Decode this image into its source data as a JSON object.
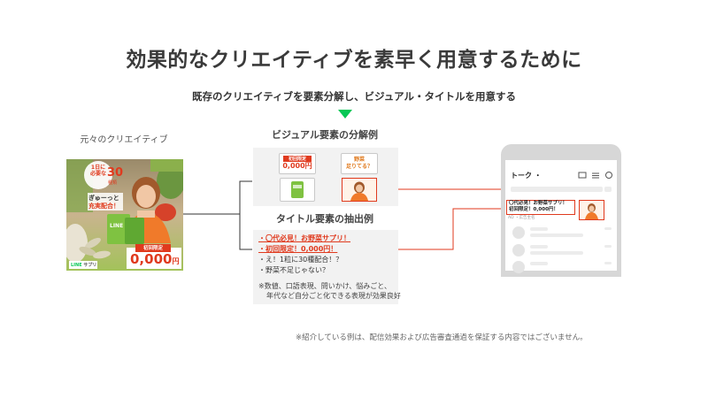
{
  "title": "効果的なクリエイティブを素早く用意するために",
  "subtitle": "既存のクリエイティブを要素分解し、ビジュアル・タイトルを用意する",
  "original_label": "元々のクリエイティブ",
  "creative": {
    "line1": "1日に",
    "line2": "必要な",
    "num": "30",
    "unit": "種類",
    "tagline1": "ぎゅーっと",
    "tagline2": "充実配合！",
    "badge_top": "初回限定",
    "price": "0,000",
    "price_unit": "円",
    "logo": "LINE",
    "logo_sub": "サプリ",
    "pkg": "LINE"
  },
  "visual_section": {
    "title": "ビジュアル要素の分解例",
    "thumb1_top": "初回限定",
    "thumb1_price": "0,000円",
    "thumb2_line1": "野菜",
    "thumb2_line2": "足りてる？"
  },
  "title_section": {
    "title": "タイトル要素の抽出例",
    "items": [
      "・〇代必見！お野菜サプリ！",
      "・初回限定！0,000円！",
      "・え！1粒に30種配合！？",
      "・野菜不足じゃない？"
    ],
    "note1": "※数値、口語表現、問いかけ、悩みごと、",
    "note2": "年代など自分ごと化できる表現が効果良好"
  },
  "phone": {
    "header": "トーク",
    "dot": "・",
    "ad_line1": "〇代必見！お野菜サプリ！",
    "ad_line2": "初回限定！0,000円！",
    "ad_meta": "AD ・広告主名"
  },
  "footnote": "※紹介している例は、配信効果および広告審査通過を保証する内容ではございません。",
  "colors": {
    "accent_green": "#06c755",
    "highlight_red": "#e03a1e",
    "creative_orange": "#f07a2a"
  }
}
